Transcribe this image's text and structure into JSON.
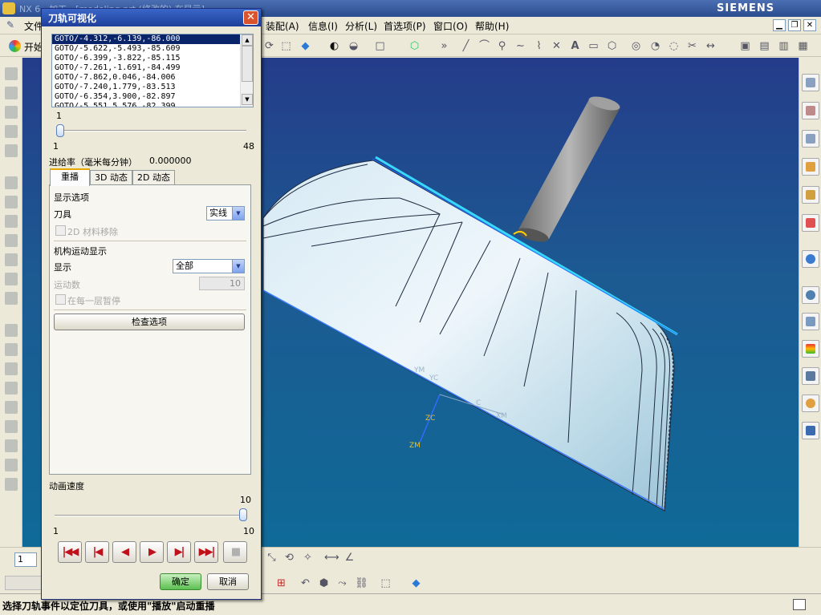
{
  "app": {
    "title_fragment": "NX 6 - 加工 - [modeling.prt (修改的) 在显示]",
    "brand": "SIEMENS"
  },
  "menu": {
    "file": "文件",
    "assembly": "装配(A)",
    "info": "信息(I)",
    "analysis": "分析(L)",
    "preferences": "首选项(P)",
    "window": "窗口(O)",
    "help": "帮助(H)"
  },
  "toolbar": {
    "start": "开始"
  },
  "dialog": {
    "title": "刀轨可视化",
    "gotos": [
      "GOTO/-4.312,-6.139,-86.000",
      "GOTO/-5.622,-5.493,-85.609",
      "GOTO/-6.399,-3.822,-85.115",
      "GOTO/-7.261,-1.691,-84.499",
      "GOTO/-7.862,0.046,-84.006",
      "GOTO/-7.240,1.779,-83.513",
      "GOTO/-6.354,3.900,-82.897",
      "GOTO/-5.551,5.576,-82.399"
    ],
    "slider_value": "1",
    "slider_min": "1",
    "slider_max": "48",
    "feed_label": "进给率（毫米每分钟）",
    "feed_value": "0.000000",
    "tabs": [
      "重播",
      "3D 动态",
      "2D 动态"
    ],
    "display_options": "显示选项",
    "tool_label": "刀具",
    "tool_value": "实线",
    "material_removal": "2D 材料移除",
    "motion_display": "机构运动显示",
    "display_label": "显示",
    "display_value": "全部",
    "motion_count_label": "运动数",
    "motion_count_value": "10",
    "pause_each_layer": "在每一层暂停",
    "check_options": "检查选项",
    "anim_speed": "动画速度",
    "speed_value": "10",
    "speed_min": "1",
    "speed_max": "10",
    "ok": "确定",
    "cancel": "取消"
  },
  "viewport": {
    "labels": {
      "ym": "YM",
      "yc": "YC",
      "zc": "ZC",
      "zm": "ZM",
      "xc": "C",
      "xm": "XM"
    }
  },
  "bottom": {
    "layer_value": "1"
  },
  "status": "选择刀轨事件以定位刀具，或使用\"播放\"启动重播"
}
